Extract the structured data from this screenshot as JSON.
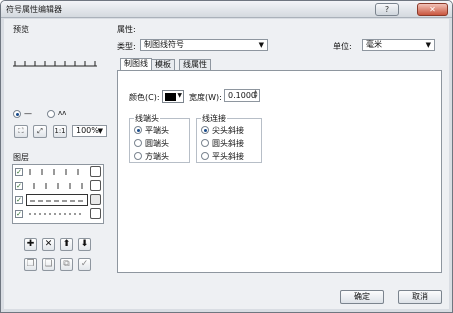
{
  "window": {
    "title": "符号属性编辑器",
    "help_btn": "?",
    "min_btn": "–",
    "close_btn": "✕"
  },
  "preview": {
    "label": "预览",
    "radio_solid_label": "—",
    "radio_wave_label": "ʌʌ",
    "zoom_value": "100%"
  },
  "layers": {
    "label": "图层",
    "rows": [
      {
        "checked": true,
        "pattern": "ticks"
      },
      {
        "checked": true,
        "pattern": "ticks"
      },
      {
        "checked": true,
        "pattern": "dash",
        "selected": true
      },
      {
        "checked": true,
        "pattern": "dots"
      }
    ],
    "buttons": [
      "✚",
      "✕",
      "⬆",
      "⬇"
    ],
    "buttons_row2": [
      "copy",
      "paste",
      "group",
      "clear"
    ]
  },
  "properties": {
    "label": "属性:",
    "type_label": "类型:",
    "type_value": "制图线符号",
    "unit_label": "单位:",
    "unit_value": "毫米",
    "tabs": [
      "制图线",
      "模板",
      "线属性"
    ],
    "color_label": "颜色(C):",
    "width_label": "宽度(W):",
    "width_value": "0.1000",
    "cap_group": {
      "title": "线端头",
      "options": [
        "平端头",
        "圆端头",
        "方端头"
      ],
      "selected": 0
    },
    "join_group": {
      "title": "线连接",
      "options": [
        "尖头斜接",
        "圆头斜接",
        "平头斜接"
      ],
      "selected": 0
    }
  },
  "footer": {
    "ok_label": "确定",
    "cancel_label": "取消"
  },
  "colors": {
    "accent": "#1a4c8c",
    "window_bg": "#eef0f3"
  }
}
